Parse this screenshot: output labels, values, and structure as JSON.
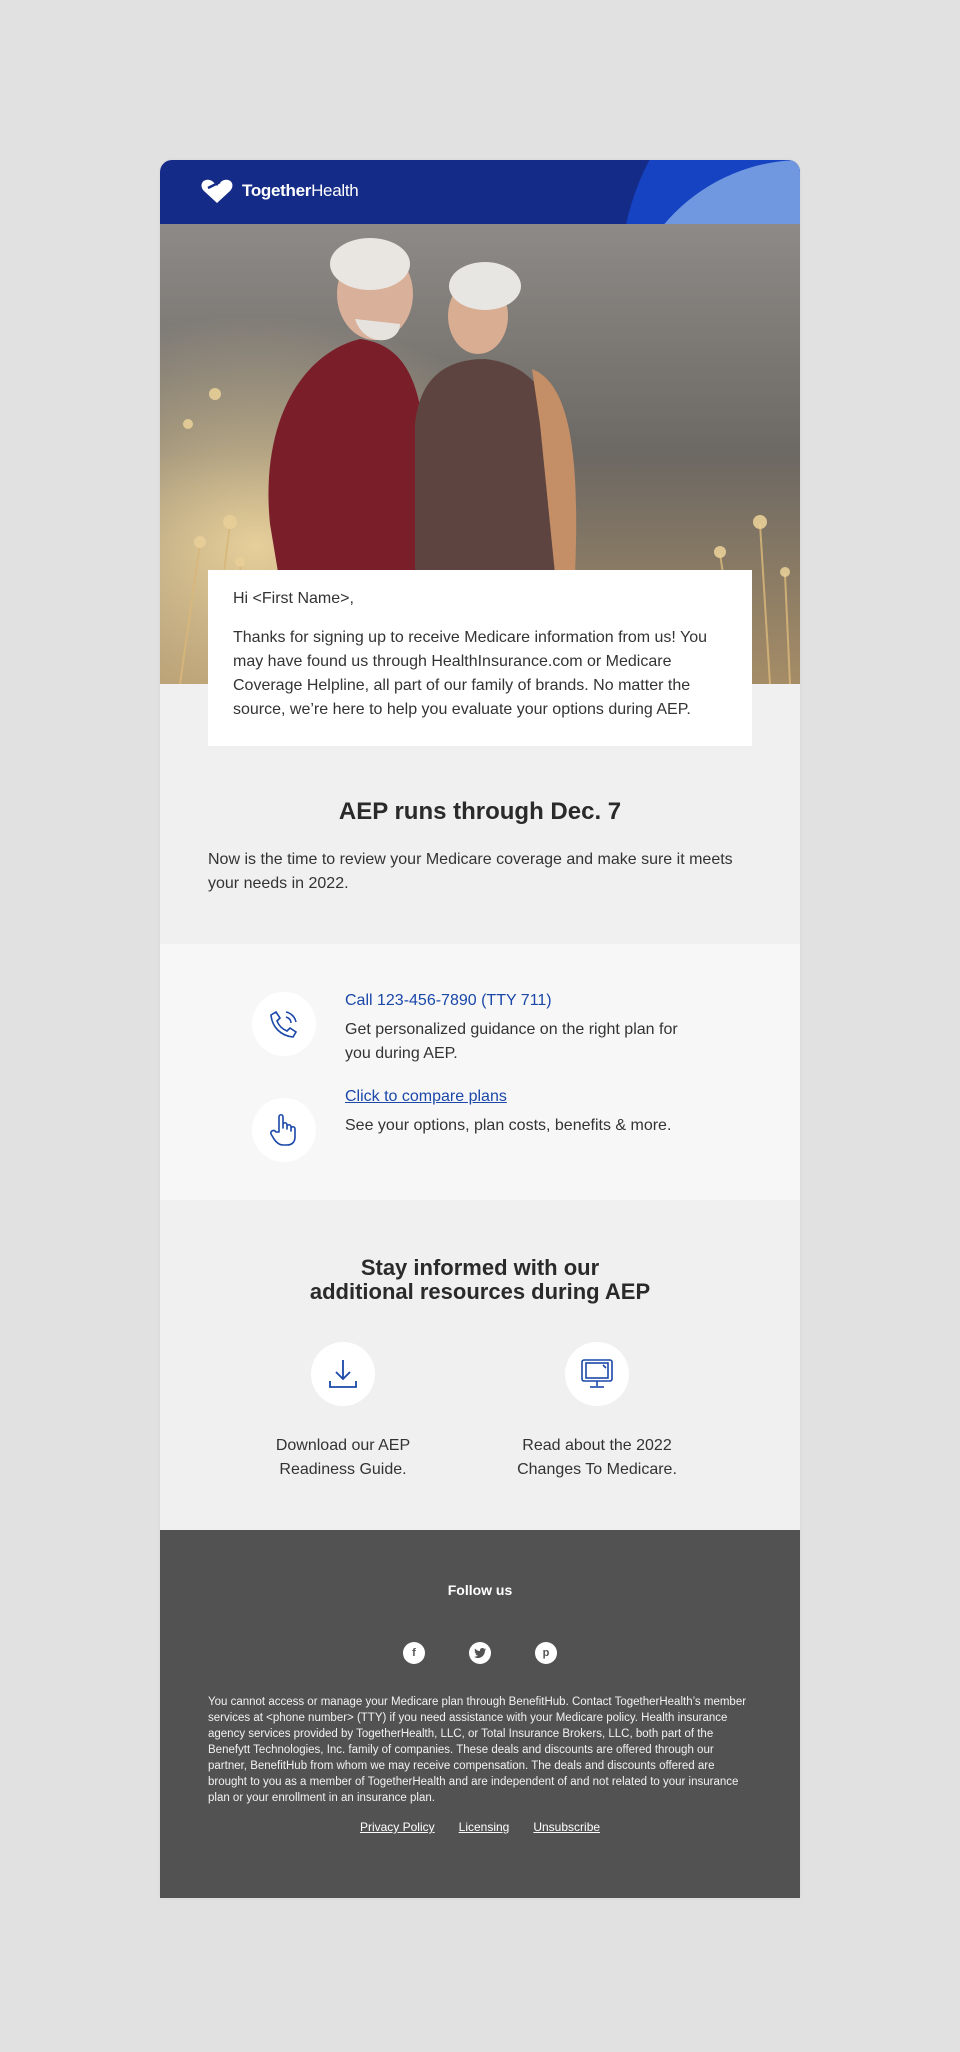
{
  "brand": {
    "logo_bold": "Together",
    "logo_regular": "Health"
  },
  "greeting": {
    "hi": "Hi <First Name>,",
    "body": "Thanks for signing up to receive Medicare information from us! You may have found us through HealthInsurance.com or Medicare Coverage Helpline, all part of our family of brands. No matter the source, we’re here to help you evaluate your options during AEP."
  },
  "aep": {
    "title": "AEP runs through Dec. 7",
    "body": "Now is the time to review your Medicare coverage and make sure it meets your needs in 2022."
  },
  "contact": {
    "call_label": "Call 123-456-7890 (TTY 711)",
    "call_desc": "Get personalized guidance on the right plan for you during AEP.",
    "compare_label": "Click to compare plans",
    "compare_desc": "See your options, plan costs, benefits & more."
  },
  "resources": {
    "title_line1": "Stay informed with our",
    "title_line2": "additional resources during AEP",
    "download_line1": "Download our AEP",
    "download_line2": "Readiness Guide.",
    "read_line1": "Read about the 2022",
    "read_line2": "Changes To Medicare."
  },
  "footer": {
    "follow": "Follow us",
    "social": [
      "f",
      "t",
      "p"
    ],
    "disclaimer": "You cannot access or manage your Medicare plan through BenefitHub.  Contact TogetherHealth’s member services at <phone number> (TTY) if you need assistance with your Medicare policy. Health insurance agency services provided by TogetherHealth, LLC, or Total Insurance Brokers, LLC, both part of the Benefytt Technologies, Inc. family of companies. These deals and discounts are offered through our partner, BenefitHub from whom we may receive compensation. The deals and discounts offered are brought to you as a member of TogetherHealth and are independent of and not related to your insurance plan or your enrollment in an insurance plan.",
    "privacy": "Privacy Policy",
    "licensing": "Licensing",
    "unsubscribe": "Unsubscribe"
  },
  "colors": {
    "header_navy": "#142b87",
    "header_blue": "#1643c2",
    "header_light_blue": "#7098e0",
    "link_blue": "#1a47a8",
    "footer_gray": "#525252"
  }
}
